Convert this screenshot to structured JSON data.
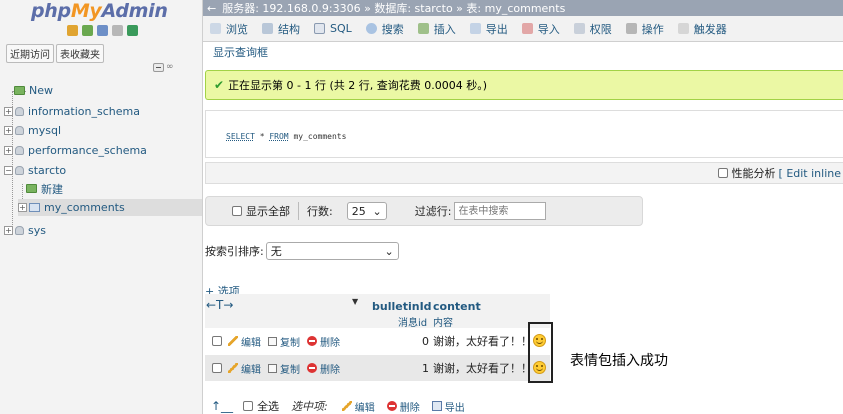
{
  "logo": {
    "prefix": "php",
    "mid": "My",
    "suffix": "Admin"
  },
  "sidebar": {
    "tabs": [
      "近期访问",
      "表收藏夹"
    ],
    "tree": [
      {
        "label": "New",
        "kind": "new"
      },
      {
        "label": "information_schema",
        "kind": "db"
      },
      {
        "label": "mysql",
        "kind": "db"
      },
      {
        "label": "performance_schema",
        "kind": "db"
      },
      {
        "label": "starcto",
        "kind": "db"
      },
      {
        "label": "新建",
        "kind": "new"
      },
      {
        "label": "my_comments",
        "kind": "table"
      },
      {
        "label": "sys",
        "kind": "db"
      }
    ]
  },
  "breadcrumb": "服务器: 192.168.0.9:3306 » 数据库: starcto » 表: my_comments",
  "tabs": [
    "浏览",
    "结构",
    "SQL",
    "搜索",
    "插入",
    "导出",
    "导入",
    "权限",
    "操作",
    "触发器"
  ],
  "show_query": "显示查询框",
  "success_msg": "正在显示第 0 - 1 行 (共 2 行, 查询花费 0.0004 秒。)",
  "sql": {
    "select": "SELECT",
    "star": " * ",
    "from": "FROM",
    "table": " my_comments"
  },
  "profile": {
    "label": "性能分析",
    "edit": "[ Edit inline"
  },
  "nav": {
    "show_all": "显示全部",
    "rows_label": "行数:",
    "rows_value": "25",
    "filter_label": "过滤行:",
    "filter_placeholder": "在表中搜索"
  },
  "sort": {
    "label": "按索引排序:",
    "value": "无"
  },
  "options_link": "+ 选项",
  "columns": [
    {
      "name": "bulletinId",
      "comment": "消息id"
    },
    {
      "name": "content",
      "comment": "内容"
    }
  ],
  "actions": {
    "edit": "编辑",
    "copy": "复制",
    "delete": "删除"
  },
  "rows": [
    {
      "id": "0",
      "content": "谢谢，太好看了！！"
    },
    {
      "id": "1",
      "content": "谢谢，太好看了！！"
    }
  ],
  "annotation": "表情包插入成功",
  "footer": {
    "select_all": "全选",
    "with_selected": "选中项:",
    "edit": "编辑",
    "delete": "删除",
    "export": "导出"
  },
  "colors": {
    "accent": "#235a81",
    "success_bg": "#ebf8a4",
    "logo_blue": "#5c6ea9",
    "logo_orange": "#f29623"
  }
}
